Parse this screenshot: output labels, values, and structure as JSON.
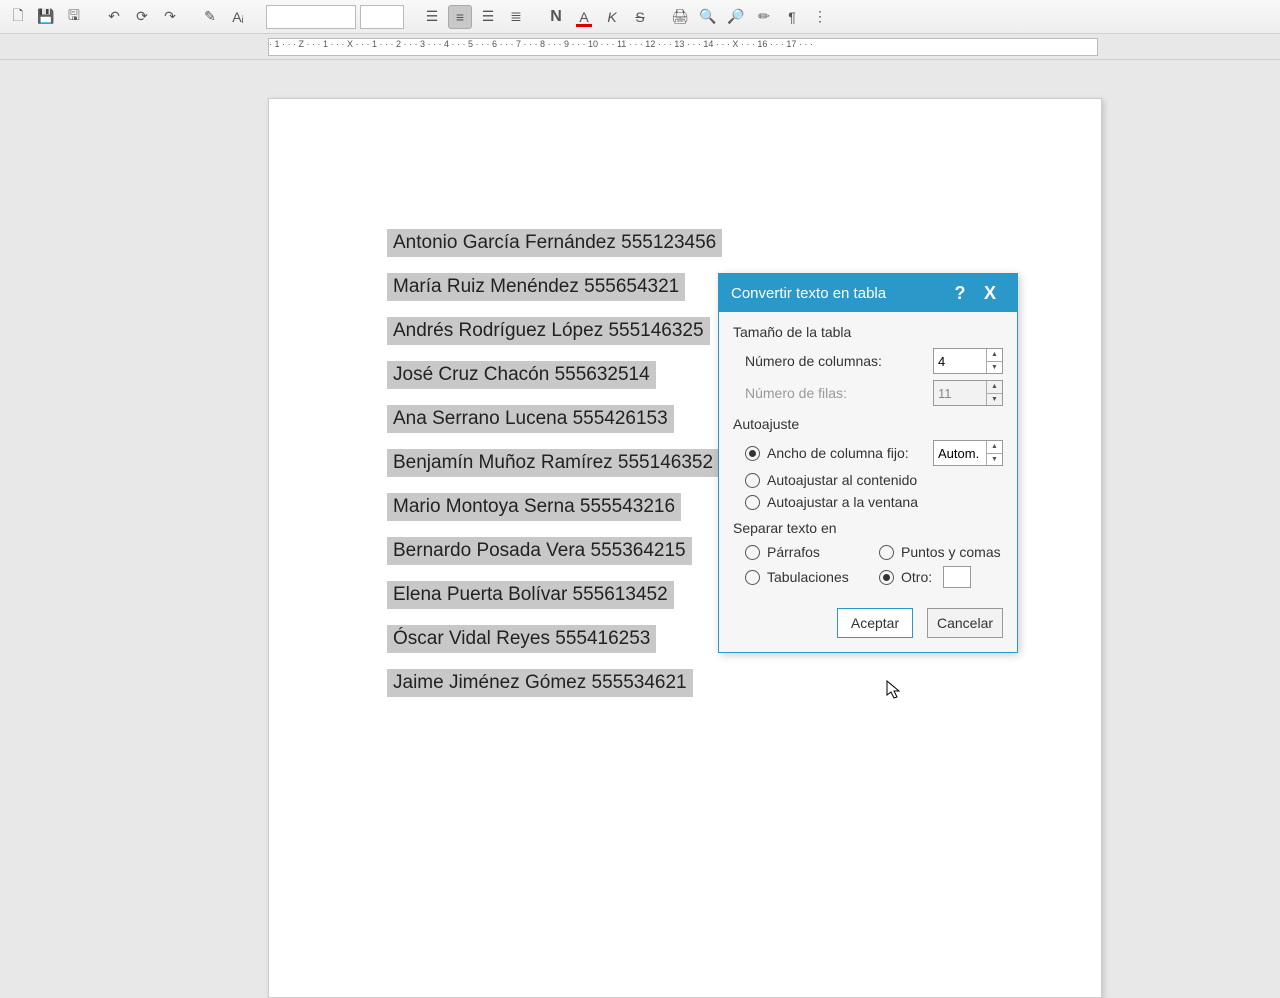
{
  "toolbar": {
    "font_name": "",
    "font_size": ""
  },
  "document": {
    "lines": [
      "Antonio García Fernández 555123456",
      "María Ruiz Menéndez 555654321",
      "Andrés Rodríguez López 555146325",
      "José Cruz Chacón 555632514",
      "Ana Serrano Lucena 555426153",
      "Benjamín Muñoz Ramírez 555146352",
      "Mario Montoya Serna 555543216",
      "Bernardo Posada Vera 555364215",
      "Elena Puerta Bolívar 555613452",
      "Óscar Vidal Reyes 555416253",
      "Jaime Jiménez Gómez 555534621"
    ]
  },
  "dialog": {
    "title": "Convertir texto en tabla",
    "help_symbol": "?",
    "close_symbol": "X",
    "section_size": "Tamaño de la tabla",
    "columns_label": "Número de columnas:",
    "columns_value": "4",
    "rows_label": "Número de filas:",
    "rows_value": "11",
    "section_autofit": "Autoajuste",
    "fixed_width_label": "Ancho de columna fijo:",
    "fixed_width_value": "Autom.",
    "autofit_content_label": "Autoajustar al contenido",
    "autofit_window_label": "Autoajustar a la ventana",
    "section_separate": "Separar texto en",
    "sep_paragraphs": "Párrafos",
    "sep_semicolons": "Puntos y comas",
    "sep_tabs": "Tabulaciones",
    "sep_other": "Otro:",
    "sep_other_value": "",
    "btn_accept": "Aceptar",
    "btn_cancel": "Cancelar"
  },
  "ruler": {
    "marks": "· 1 · · · Z · · · 1 · · · X · · · 1 · · · 2 · · · 3 · · · 4 · · · 5 · · · 6 · · · 7 · · · 8 · · · 9 · · · 10 · · · 11 · · · 12 · · · 13 · · · 14 · · · X · · · 16 · · · 17 · · ·"
  }
}
